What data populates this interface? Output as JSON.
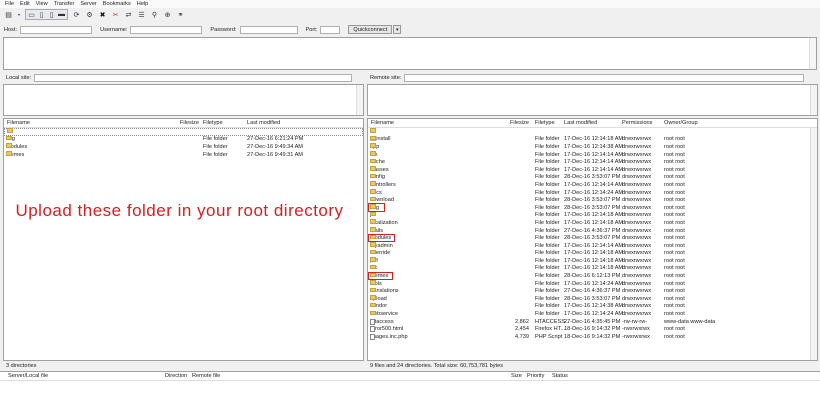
{
  "menu": [
    "File",
    "Edit",
    "View",
    "Transfer",
    "Server",
    "Bookmarks",
    "Help"
  ],
  "quickconnect": {
    "host_label": "Host:",
    "username_label": "Username:",
    "password_label": "Password:",
    "port_label": "Port:",
    "button": "Quickconnect",
    "host_value": "",
    "username_value": "",
    "password_value": "",
    "port_value": ""
  },
  "local": {
    "site_label": "Local site:",
    "site_value": "",
    "columns": {
      "filename": "Filename",
      "filesize": "Filesize",
      "filetype": "Filetype",
      "modified": "Last modified"
    },
    "rows": [
      {
        "name": "..",
        "type": "",
        "modified": ""
      },
      {
        "name": "img",
        "type": "File folder",
        "modified": "27-Dec-16 6:21:24 PM"
      },
      {
        "name": "modules",
        "type": "File folder",
        "modified": "27-Dec-16 9:49:34 AM"
      },
      {
        "name": "themes",
        "type": "File folder",
        "modified": "27-Dec-16 9:49:31 AM"
      }
    ],
    "status": "3 directories"
  },
  "remote": {
    "site_label": "Remote site:",
    "site_value": "",
    "columns": {
      "filename": "Filename",
      "filesize": "Filesize",
      "filetype": "Filetype",
      "modified": "Last modified",
      "permissions": "Permissions",
      "owner": "Owner/Group"
    },
    "rows": [
      {
        "name": "..",
        "size": "",
        "type": "",
        "modified": "",
        "perm": "",
        "owner": ""
      },
      {
        "name": "__install",
        "size": "",
        "type": "File folder",
        "modified": "17-Dec-16 12:14:18 AM",
        "perm": "drwxrwxrwx",
        "owner": "root root"
      },
      {
        "name": "app",
        "size": "",
        "type": "File folder",
        "modified": "17-Dec-16 12:14:38 AM",
        "perm": "drwxrwxrwx",
        "owner": "root root"
      },
      {
        "name": "bin",
        "size": "",
        "type": "File folder",
        "modified": "17-Dec-16 12:14:14 AM",
        "perm": "drwxrwxrwx",
        "owner": "root root"
      },
      {
        "name": "cache",
        "size": "",
        "type": "File folder",
        "modified": "17-Dec-16 12:14:14 AM",
        "perm": "drwxrwxrwx",
        "owner": "root root"
      },
      {
        "name": "classes",
        "size": "",
        "type": "File folder",
        "modified": "17-Dec-16 12:14:14 AM",
        "perm": "drwxrwxrwx",
        "owner": "root root"
      },
      {
        "name": "config",
        "size": "",
        "type": "File folder",
        "modified": "28-Dec-16 3:53:07 PM",
        "perm": "drwxrwxrwx",
        "owner": "root root"
      },
      {
        "name": "controllers",
        "size": "",
        "type": "File folder",
        "modified": "17-Dec-16 12:14:14 AM",
        "perm": "drwxrwxrwx",
        "owner": "root root"
      },
      {
        "name": "docs",
        "size": "",
        "type": "File folder",
        "modified": "17-Dec-16 12:14:24 AM",
        "perm": "drwxrwxrwx",
        "owner": "root root"
      },
      {
        "name": "download",
        "size": "",
        "type": "File folder",
        "modified": "28-Dec-16 3:53:07 PM",
        "perm": "drwxrwxrwx",
        "owner": "root root"
      },
      {
        "name": "img",
        "size": "",
        "type": "File folder",
        "modified": "28-Dec-16 3:53:07 PM",
        "perm": "drwxrwxrwx",
        "owner": "root root"
      },
      {
        "name": "js",
        "size": "",
        "type": "File folder",
        "modified": "17-Dec-16 12:14:18 AM",
        "perm": "drwxrwxrwx",
        "owner": "root root"
      },
      {
        "name": "localization",
        "size": "",
        "type": "File folder",
        "modified": "17-Dec-16 12:14:18 AM",
        "perm": "drwxrwxrwx",
        "owner": "root root"
      },
      {
        "name": "mails",
        "size": "",
        "type": "File folder",
        "modified": "27-Dec-16 4:36:37 PM",
        "perm": "drwxrwxrwx",
        "owner": "root root"
      },
      {
        "name": "modules",
        "size": "",
        "type": "File folder",
        "modified": "28-Dec-16 3:53:07 PM",
        "perm": "drwxrwxrwx",
        "owner": "root root"
      },
      {
        "name": "myadmin",
        "size": "",
        "type": "File folder",
        "modified": "17-Dec-16 12:14:14 AM",
        "perm": "drwxrwxrwx",
        "owner": "root root"
      },
      {
        "name": "override",
        "size": "",
        "type": "File folder",
        "modified": "17-Dec-16 12:14:18 AM",
        "perm": "drwxrwxrwx",
        "owner": "root root"
      },
      {
        "name": "pdf",
        "size": "",
        "type": "File folder",
        "modified": "17-Dec-16 12:14:18 AM",
        "perm": "drwxrwxrwx",
        "owner": "root root"
      },
      {
        "name": "src",
        "size": "",
        "type": "File folder",
        "modified": "17-Dec-16 12:14:18 AM",
        "perm": "drwxrwxrwx",
        "owner": "root root"
      },
      {
        "name": "themes",
        "size": "",
        "type": "File folder",
        "modified": "28-Dec-16 6:12:13 PM",
        "perm": "drwxrwxrwx",
        "owner": "root root"
      },
      {
        "name": "tools",
        "size": "",
        "type": "File folder",
        "modified": "17-Dec-16 12:14:24 AM",
        "perm": "drwxrwxrwx",
        "owner": "root root"
      },
      {
        "name": "translations",
        "size": "",
        "type": "File folder",
        "modified": "27-Dec-16 4:36:37 PM",
        "perm": "drwxrwxrwx",
        "owner": "root root"
      },
      {
        "name": "upload",
        "size": "",
        "type": "File folder",
        "modified": "28-Dec-16 3:53:07 PM",
        "perm": "drwxrwxrwx",
        "owner": "root root"
      },
      {
        "name": "vendor",
        "size": "",
        "type": "File folder",
        "modified": "17-Dec-16 12:14:38 AM",
        "perm": "drwxrwxrwx",
        "owner": "root root"
      },
      {
        "name": "webservice",
        "size": "",
        "type": "File folder",
        "modified": "17-Dec-16 12:14:24 AM",
        "perm": "drwxrwxrwx",
        "owner": "root root"
      },
      {
        "name": ".htaccess",
        "size": "2,862",
        "type": "HTACCESS...",
        "modified": "27-Dec-16 4:35:45 PM",
        "perm": "-rw-rw-rw-",
        "owner": "www-data www-data"
      },
      {
        "name": "error500.html",
        "size": "2,454",
        "type": "Firefox HT...",
        "modified": "18-Dec-16 9:14:32 PM",
        "perm": "-rwxrwxrwx",
        "owner": "root root"
      },
      {
        "name": "images.inc.php",
        "size": "4,739",
        "type": "PHP Script",
        "modified": "18-Dec-16 9:14:32 PM",
        "perm": "-rwxrwxrwx",
        "owner": "root root"
      }
    ],
    "status": "9 files and 24 directories. Total size: 60,753,781 bytes"
  },
  "queue": {
    "columns": {
      "server": "Server/Local file",
      "direction": "Direction",
      "remote": "Remote file",
      "size": "Size",
      "priority": "Priority",
      "status": "Status"
    }
  },
  "overlay_text": "Upload these folder in your root directory",
  "highlight_color": "#d42020"
}
